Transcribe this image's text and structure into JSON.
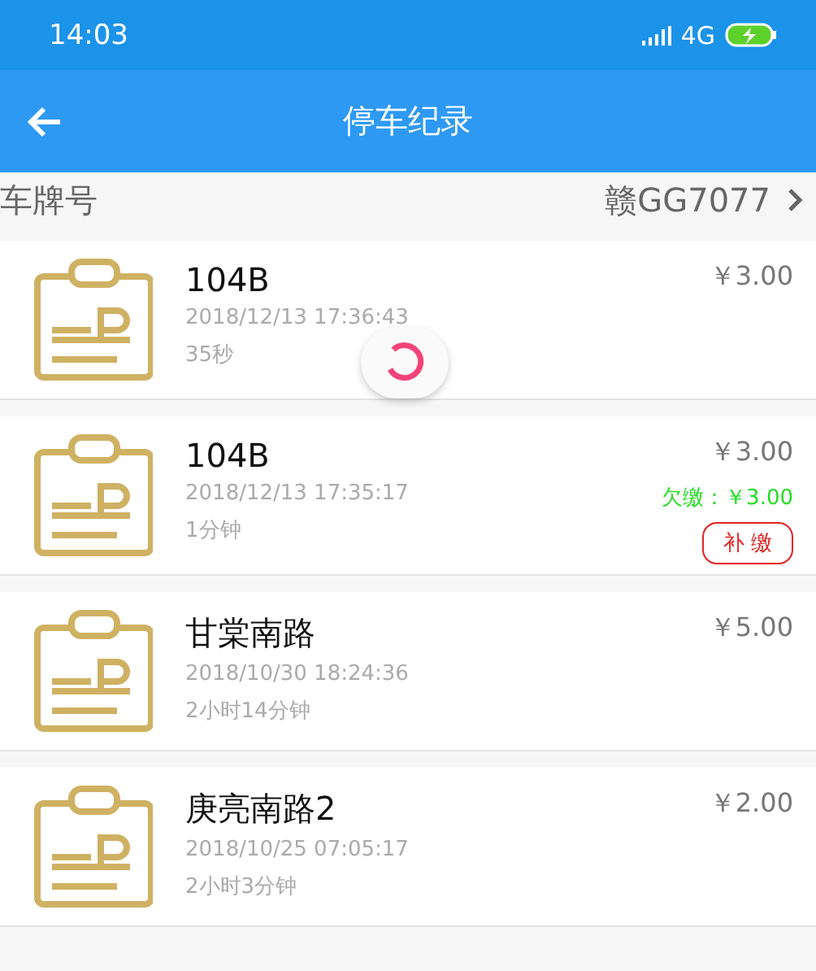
{
  "status_bar": {
    "time": "14:03",
    "network": "4G"
  },
  "header": {
    "title": "停车纪录"
  },
  "plate": {
    "label": "车牌号",
    "value": "赣GG7077"
  },
  "loading": true,
  "records": [
    {
      "name": "104B",
      "time": "2018/12/13 17:36:43",
      "duration": "35秒",
      "amount": "￥3.00"
    },
    {
      "name": "104B",
      "time": "2018/12/13 17:35:17",
      "duration": "1分钟",
      "amount": "￥3.00",
      "arrears": "欠缴：￥3.00",
      "action": "补 缴"
    },
    {
      "name": "甘棠南路",
      "time": "2018/10/30 18:24:36",
      "duration": "2小时14分钟",
      "amount": "￥5.00"
    },
    {
      "name": "庚亮南路2",
      "time": "2018/10/25 07:05:17",
      "duration": "2小时3分钟",
      "amount": "￥2.00"
    }
  ]
}
